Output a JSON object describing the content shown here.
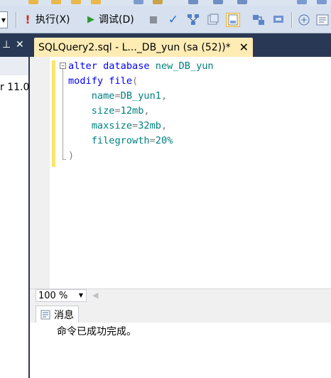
{
  "toolbar": {
    "execute_label": "执行(X)",
    "debug_label": "调试(D)"
  },
  "left_panel": {
    "truncated_text": "r 11.0"
  },
  "document_tab": {
    "title": "SQLQuery2.sql - L..._DB_yun (sa (52))*"
  },
  "editor": {
    "lines": [
      {
        "parts": [
          {
            "t": "alter",
            "c": "kw"
          },
          {
            "t": " ",
            "c": "plain"
          },
          {
            "t": "database",
            "c": "kw"
          },
          {
            "t": " new_DB_yun",
            "c": "id"
          }
        ]
      },
      {
        "parts": [
          {
            "t": "modify",
            "c": "kw"
          },
          {
            "t": " ",
            "c": "plain"
          },
          {
            "t": "file",
            "c": "kw"
          },
          {
            "t": "(",
            "c": "op"
          }
        ]
      },
      {
        "parts": [
          {
            "t": "    name",
            "c": "id"
          },
          {
            "t": "=",
            "c": "op"
          },
          {
            "t": "DB_yun1",
            "c": "id"
          },
          {
            "t": ",",
            "c": "op"
          }
        ]
      },
      {
        "parts": [
          {
            "t": "    size",
            "c": "id"
          },
          {
            "t": "=",
            "c": "op"
          },
          {
            "t": "12mb",
            "c": "id"
          },
          {
            "t": ",",
            "c": "op"
          }
        ]
      },
      {
        "parts": [
          {
            "t": "    maxsize",
            "c": "id"
          },
          {
            "t": "=",
            "c": "op"
          },
          {
            "t": "32mb",
            "c": "id"
          },
          {
            "t": ",",
            "c": "op"
          }
        ]
      },
      {
        "parts": [
          {
            "t": "    filegrowth",
            "c": "id"
          },
          {
            "t": "=",
            "c": "op"
          },
          {
            "t": "20%",
            "c": "id"
          }
        ]
      },
      {
        "parts": [
          {
            "t": ")",
            "c": "op"
          }
        ]
      }
    ]
  },
  "status_bar": {
    "zoom": "100 %"
  },
  "results": {
    "messages_tab_label": "消息",
    "message": "命令已成功完成。"
  },
  "colors": {
    "keyword": "#0000ff",
    "identifier": "#008080",
    "operator": "#808080",
    "tab_active": "#ffecb5",
    "frame": "#293955"
  }
}
